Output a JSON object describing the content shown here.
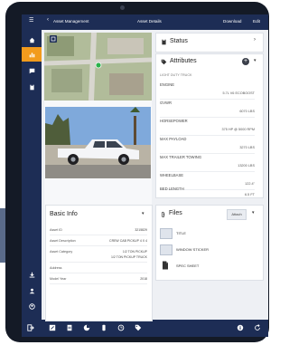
{
  "topbar": {
    "back_label": "Asset Management",
    "title": "Asset Details",
    "download": "Download",
    "edit": "Edit"
  },
  "status": {
    "title": "Status"
  },
  "attributes": {
    "title": "Attributes",
    "category": "LIGHT DUTY TRUCK",
    "rows": [
      {
        "label": "ENGINE",
        "value": "5.7L V6 ECOBOOST"
      },
      {
        "label": "GVWR",
        "value": "6070 LBS"
      },
      {
        "label": "HORSEPOWER",
        "value": "375 HP @ 5000 RPM"
      },
      {
        "label": "MAX PAYLOAD",
        "value": "3270 LBS"
      },
      {
        "label": "MAX TRAILER TOWING",
        "value": "13200 LBS"
      },
      {
        "label": "WHEELBASE",
        "value": "122.4\""
      },
      {
        "label": "BED LENGTH",
        "value": "6.5 FT"
      }
    ]
  },
  "basic_info": {
    "title": "Basic Info",
    "rows": [
      {
        "label": "Asset ID",
        "value": "3215829"
      },
      {
        "label": "Asset Description",
        "value": "CREW CAB PICKUP 4 X 4"
      },
      {
        "label": "Asset Category",
        "value": "1/2 TON PICKUP"
      },
      {
        "label": "",
        "value": "1/2 TON PICKUP TRUCK"
      },
      {
        "label": "Address",
        "value": ""
      },
      {
        "label": "Model Year",
        "value": "2018"
      }
    ]
  },
  "files": {
    "title": "Files",
    "attach": "Attach",
    "items": [
      {
        "label": "TITLE"
      },
      {
        "label": "WINDOW STICKER"
      },
      {
        "label": "SPEC SHEET"
      }
    ]
  },
  "colors": {
    "nav": "#1d2d55",
    "accent": "#f29b1d",
    "device": "#141a26"
  }
}
